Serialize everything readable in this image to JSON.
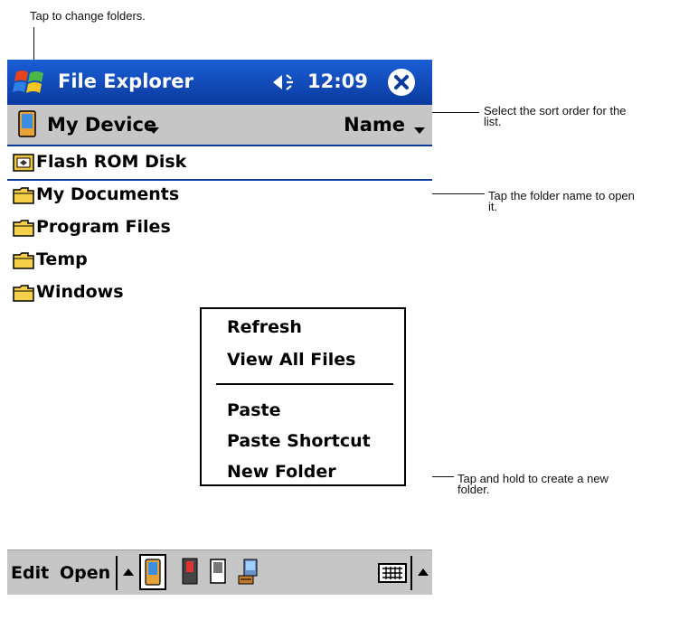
{
  "callouts": {
    "change_folders": "Tap to change folders.",
    "sort_order_line1": "Select the sort order for the",
    "sort_order_line2": "list.",
    "folder_open_line1": "Tap the folder name to open",
    "folder_open_line2": "it.",
    "new_folder_line1": "Tap and hold to create a new",
    "new_folder_line2": "folder."
  },
  "titlebar": {
    "title": "File Explorer",
    "time": "12:09"
  },
  "folderbar": {
    "location": "My Device",
    "sort": "Name"
  },
  "files": [
    {
      "name": "Flash ROM Disk",
      "icon": "storage-card-icon"
    },
    {
      "name": "My Documents",
      "icon": "folder-icon"
    },
    {
      "name": "Program Files",
      "icon": "folder-icon"
    },
    {
      "name": "Temp",
      "icon": "folder-icon"
    },
    {
      "name": "Windows",
      "icon": "folder-icon"
    }
  ],
  "context_menu": {
    "items": [
      "Refresh",
      "View All Files",
      "Paste",
      "Paste Shortcut",
      "New Folder"
    ]
  },
  "bottombar": {
    "edit": "Edit",
    "open": "Open"
  },
  "colors": {
    "titlebar": "#0a3fae",
    "toolbar_gray": "#c6c6c6",
    "accent_blue": "#0a3a9e"
  }
}
